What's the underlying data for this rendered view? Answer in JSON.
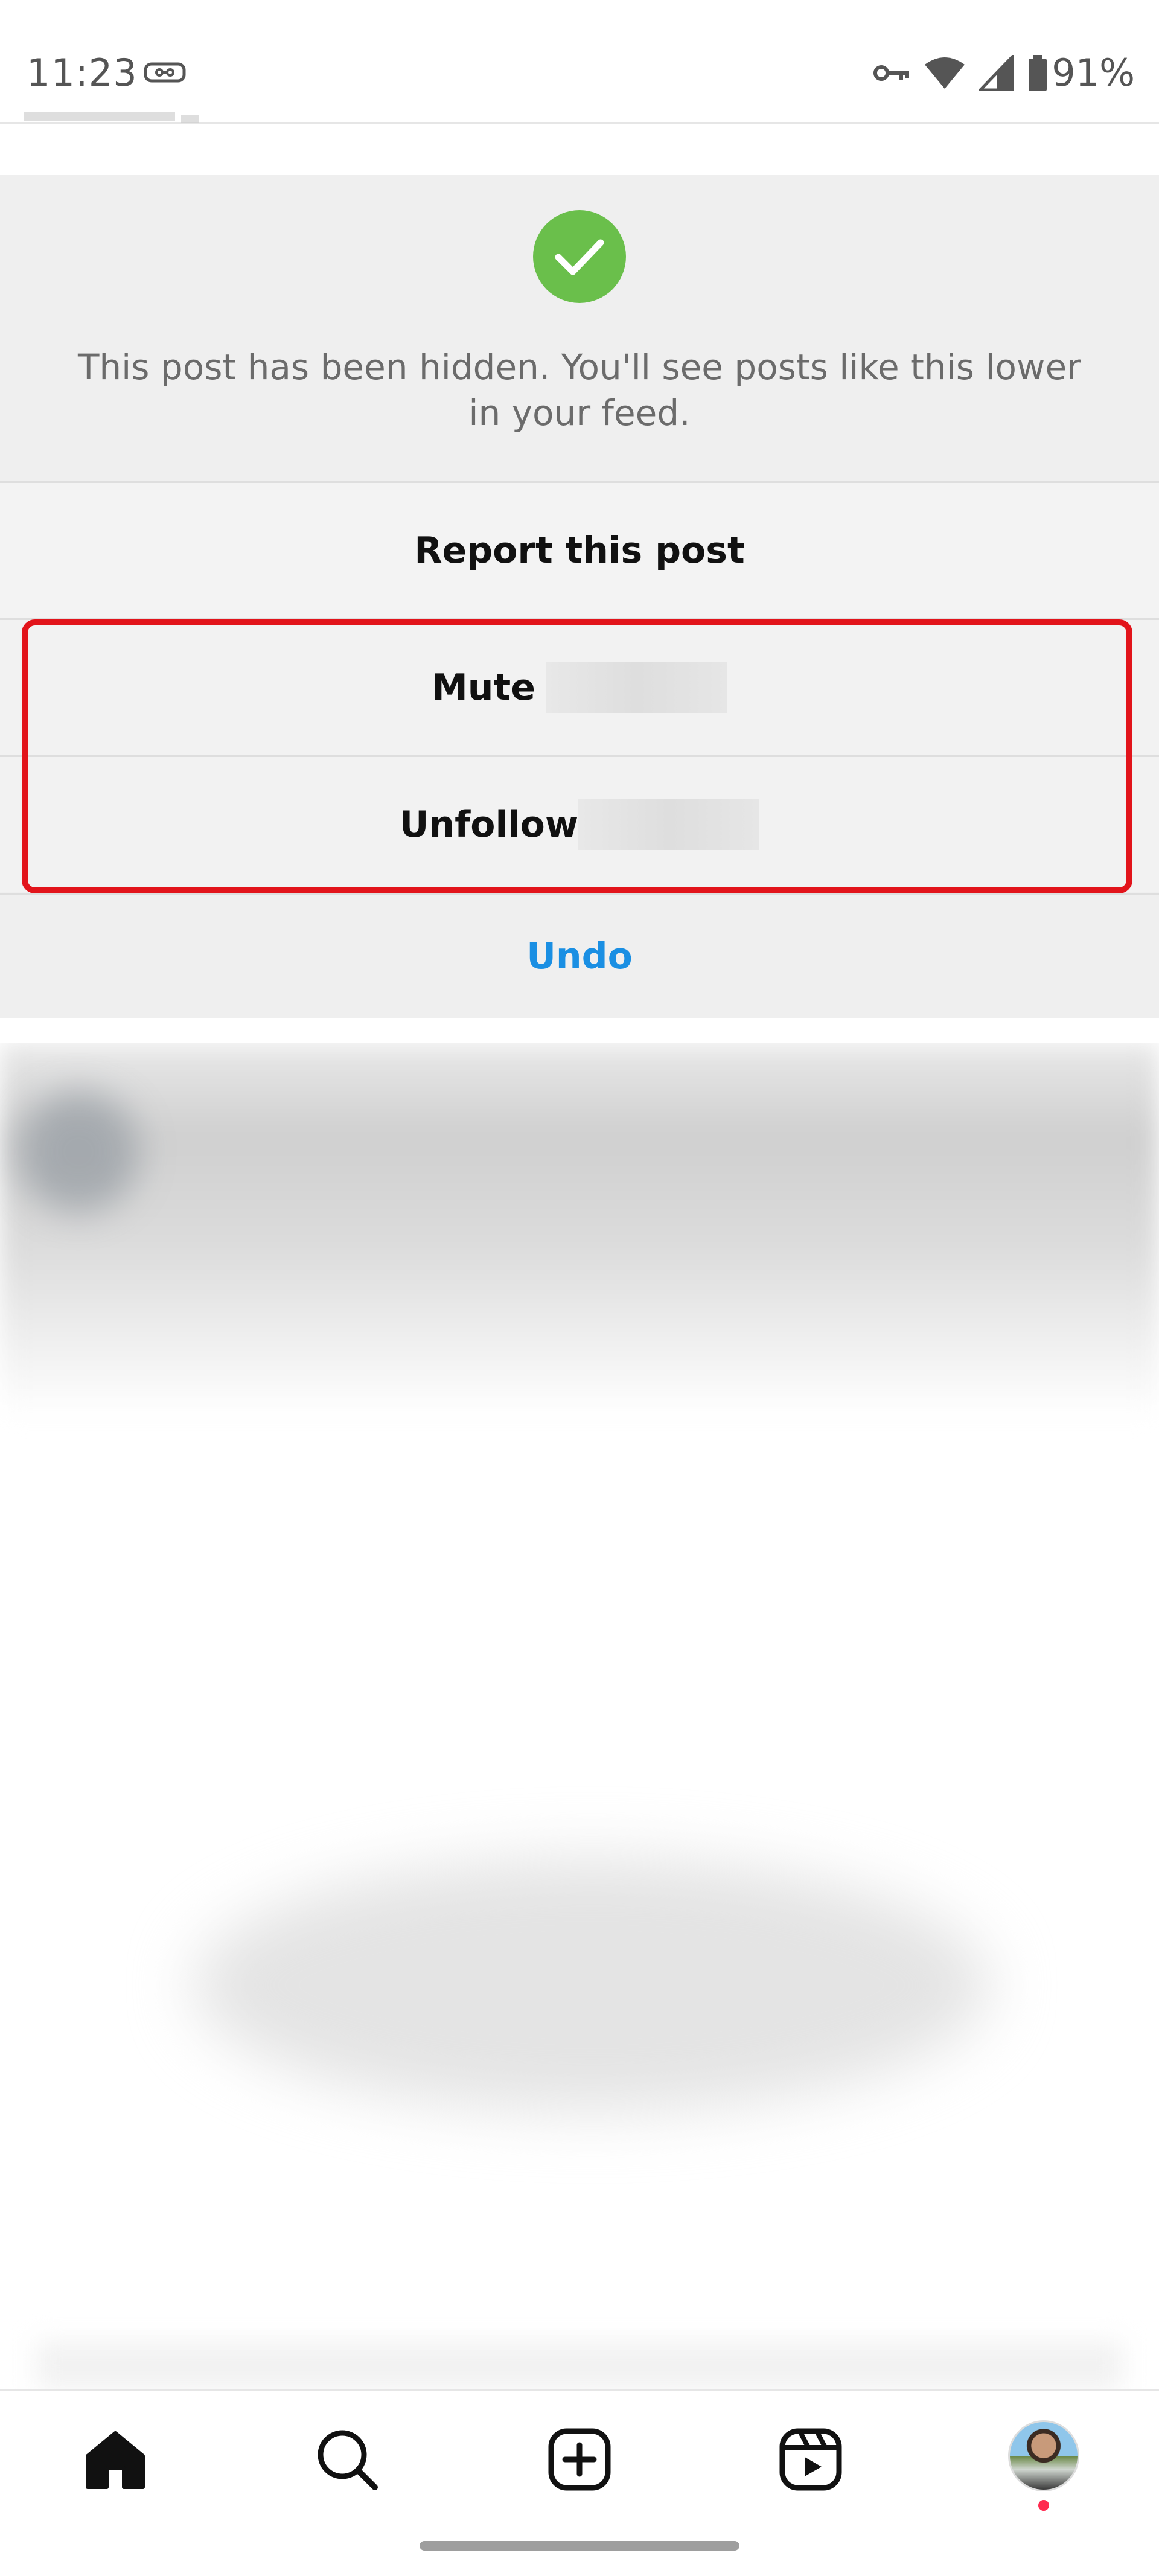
{
  "status_bar": {
    "time": "11:23",
    "battery": "91%",
    "icons": [
      "cast-icon",
      "vpn-key-icon",
      "wifi-icon",
      "signal-icon",
      "battery-icon"
    ]
  },
  "hidden_post": {
    "confirmation_icon": "check-circle-icon",
    "message": "This post has been hidden. You'll see posts like this lower in your feed.",
    "report_label": "Report this post",
    "mute_label": "Mute",
    "unfollow_label": "Unfollow",
    "undo_label": "Undo"
  },
  "bottom_nav": {
    "items": [
      "home-icon",
      "search-icon",
      "create-post-icon",
      "reels-icon",
      "profile-avatar"
    ]
  },
  "colors": {
    "success": "#6abf4b",
    "link_blue": "#1a8fe3",
    "highlight_red": "#e2141b",
    "notification_dot": "#ff2a4f"
  }
}
